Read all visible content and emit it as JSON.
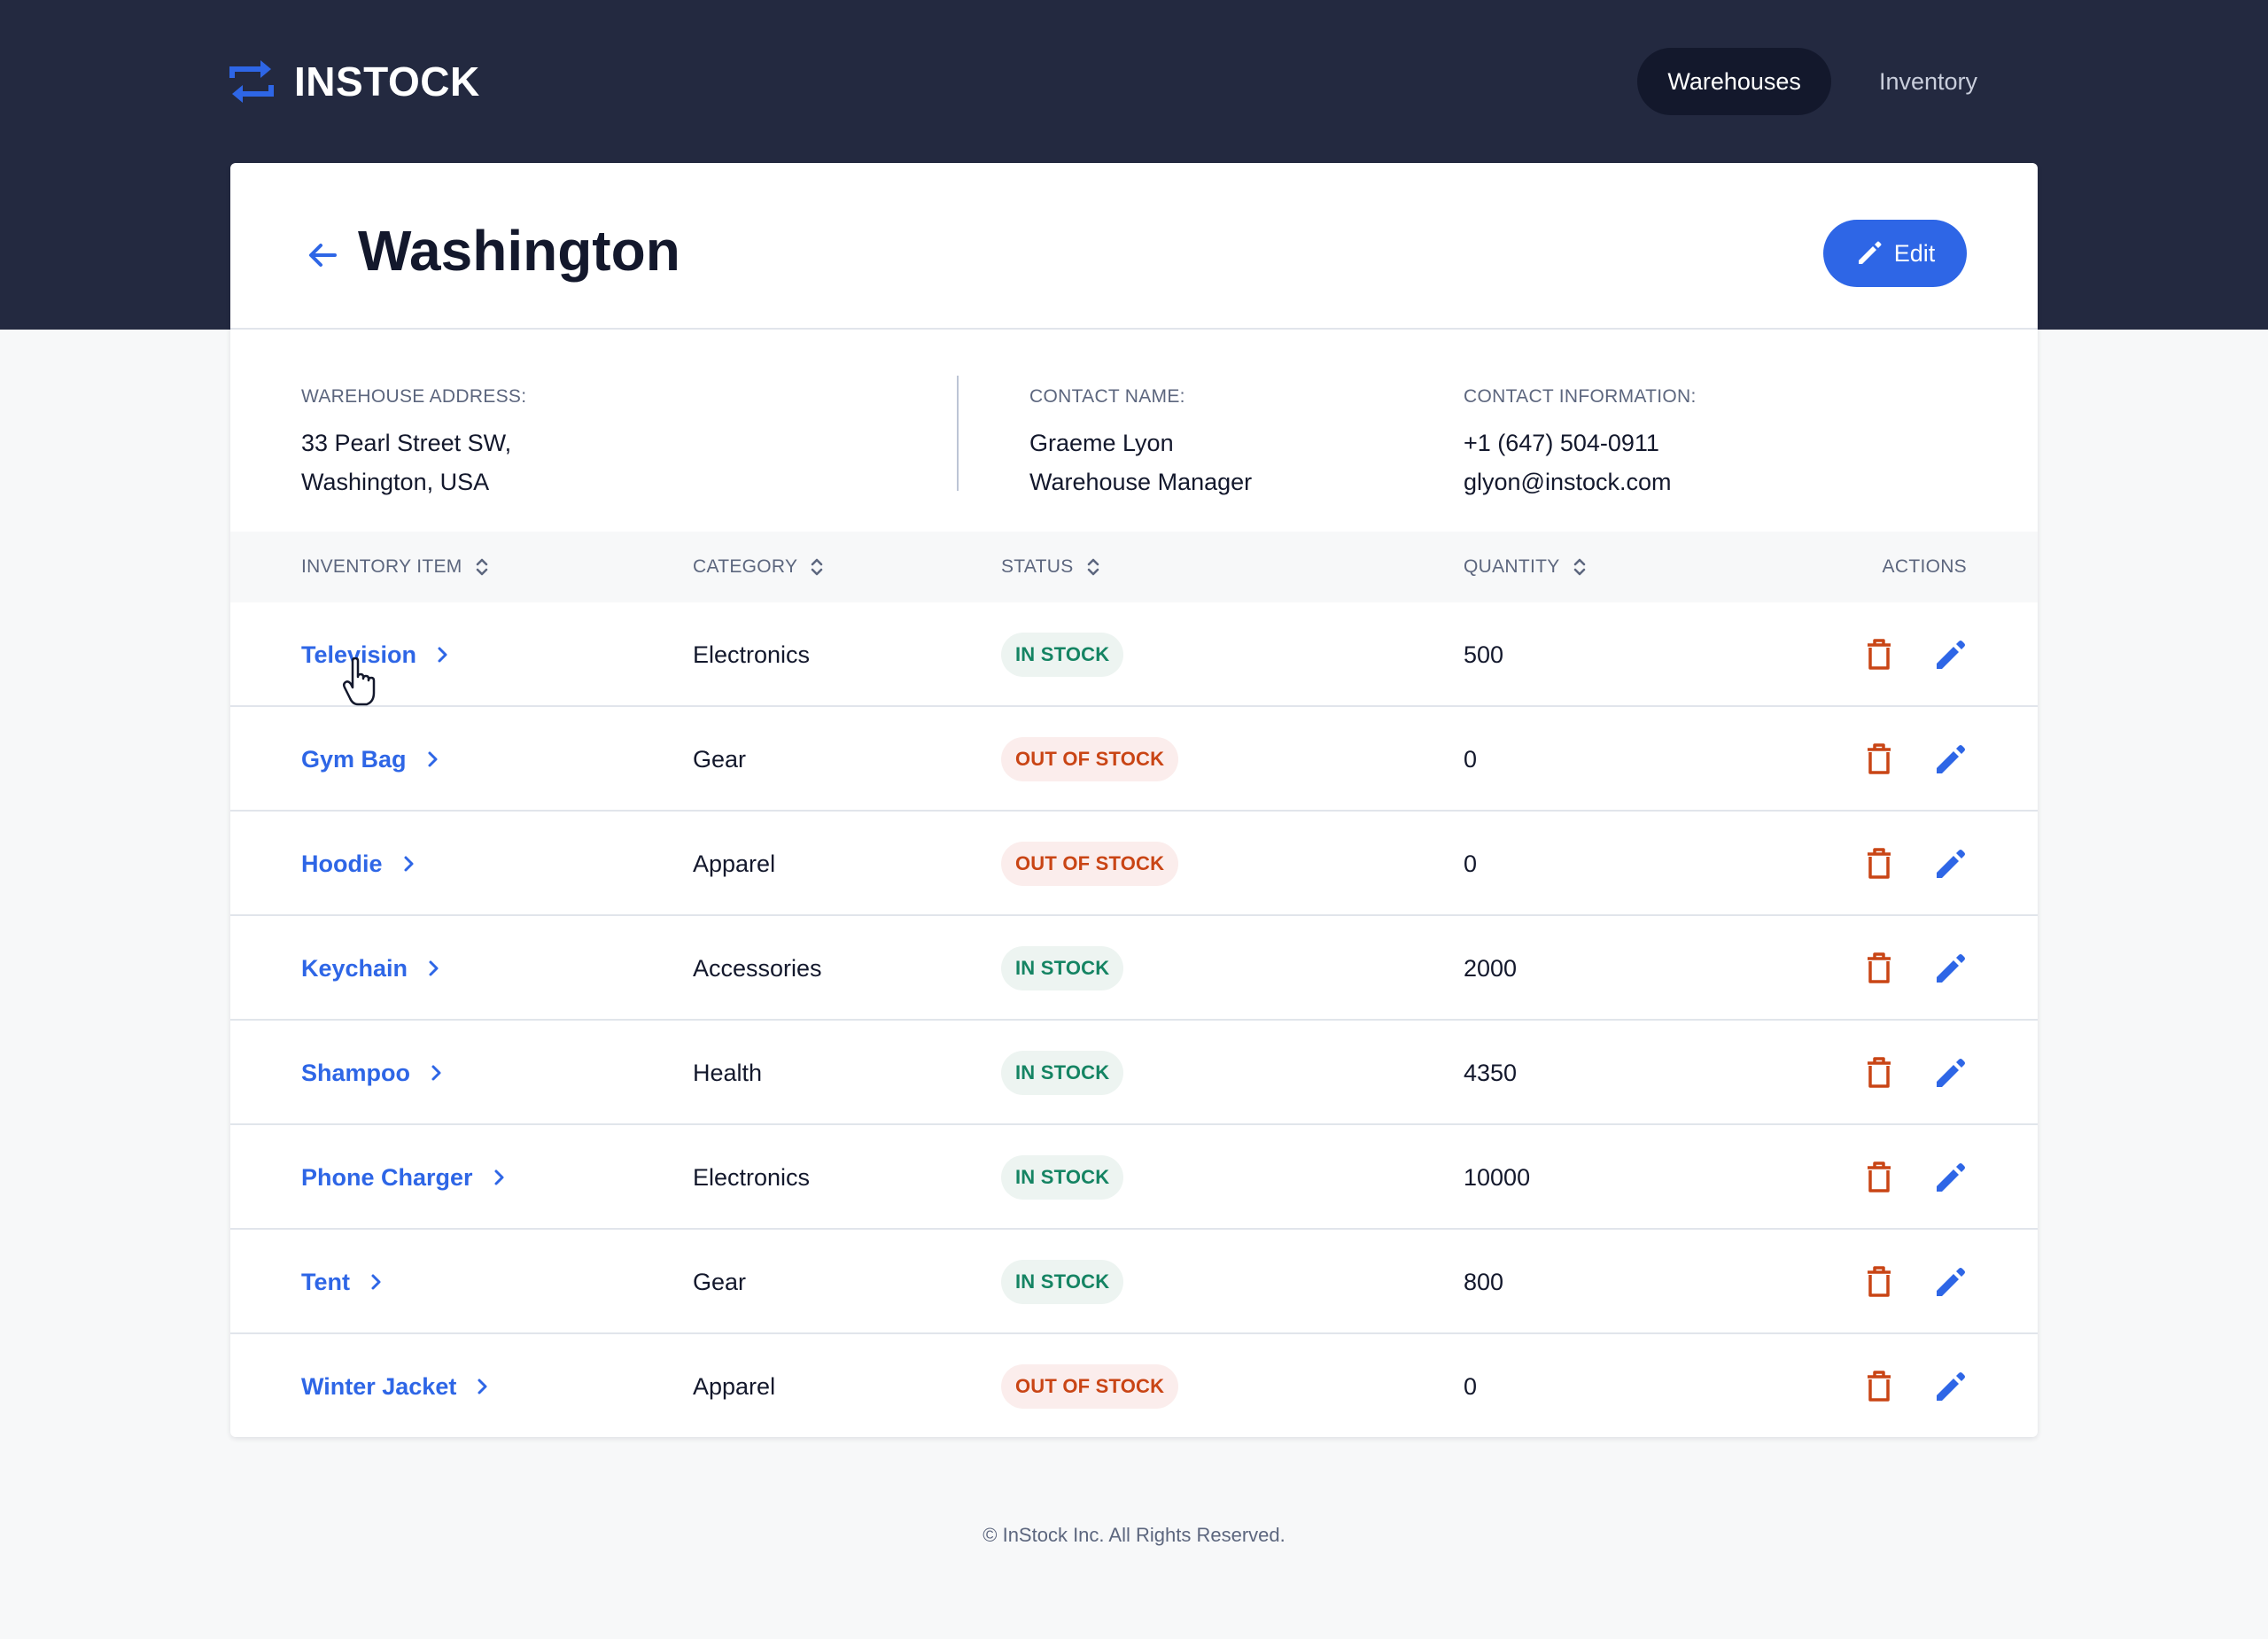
{
  "app": {
    "logo_text": "INSTOCK",
    "nav": [
      {
        "label": "Warehouses",
        "active": true
      },
      {
        "label": "Inventory",
        "active": false
      }
    ]
  },
  "warehouse": {
    "title": "Washington",
    "edit_label": "Edit",
    "address_label": "WAREHOUSE ADDRESS:",
    "address_line1": "33 Pearl Street SW,",
    "address_line2": "Washington, USA",
    "contact_name_label": "CONTACT NAME:",
    "contact_name": "Graeme Lyon",
    "contact_position": "Warehouse Manager",
    "contact_info_label": "CONTACT INFORMATION:",
    "contact_phone": "+1 (647) 504-0911",
    "contact_email": "glyon@instock.com"
  },
  "table": {
    "headers": {
      "item": "INVENTORY ITEM",
      "category": "CATEGORY",
      "status": "STATUS",
      "quantity": "QUANTITY",
      "actions": "ACTIONS"
    },
    "rows": [
      {
        "item": "Television",
        "category": "Electronics",
        "status": "IN STOCK",
        "in_stock": true,
        "quantity": "500"
      },
      {
        "item": "Gym Bag",
        "category": "Gear",
        "status": "OUT OF STOCK",
        "in_stock": false,
        "quantity": "0"
      },
      {
        "item": "Hoodie",
        "category": "Apparel",
        "status": "OUT OF STOCK",
        "in_stock": false,
        "quantity": "0"
      },
      {
        "item": "Keychain",
        "category": "Accessories",
        "status": "IN STOCK",
        "in_stock": true,
        "quantity": "2000"
      },
      {
        "item": "Shampoo",
        "category": "Health",
        "status": "IN STOCK",
        "in_stock": true,
        "quantity": "4350"
      },
      {
        "item": "Phone Charger",
        "category": "Electronics",
        "status": "IN STOCK",
        "in_stock": true,
        "quantity": "10000"
      },
      {
        "item": "Tent",
        "category": "Gear",
        "status": "IN STOCK",
        "in_stock": true,
        "quantity": "800"
      },
      {
        "item": "Winter Jacket",
        "category": "Apparel",
        "status": "OUT OF STOCK",
        "in_stock": false,
        "quantity": "0"
      }
    ]
  },
  "footer": {
    "copyright": "© InStock Inc. All Rights Reserved."
  },
  "colors": {
    "header_bg": "#232940",
    "accent": "#2E66E6",
    "in_stock": "#158463",
    "out_of_stock": "#C94515"
  },
  "icons": {
    "logo": "swap-arrows-icon",
    "back": "arrow-left-icon",
    "edit": "pencil-icon",
    "sort": "sort-icon",
    "chevron": "chevron-right-icon",
    "delete": "trash-icon"
  }
}
